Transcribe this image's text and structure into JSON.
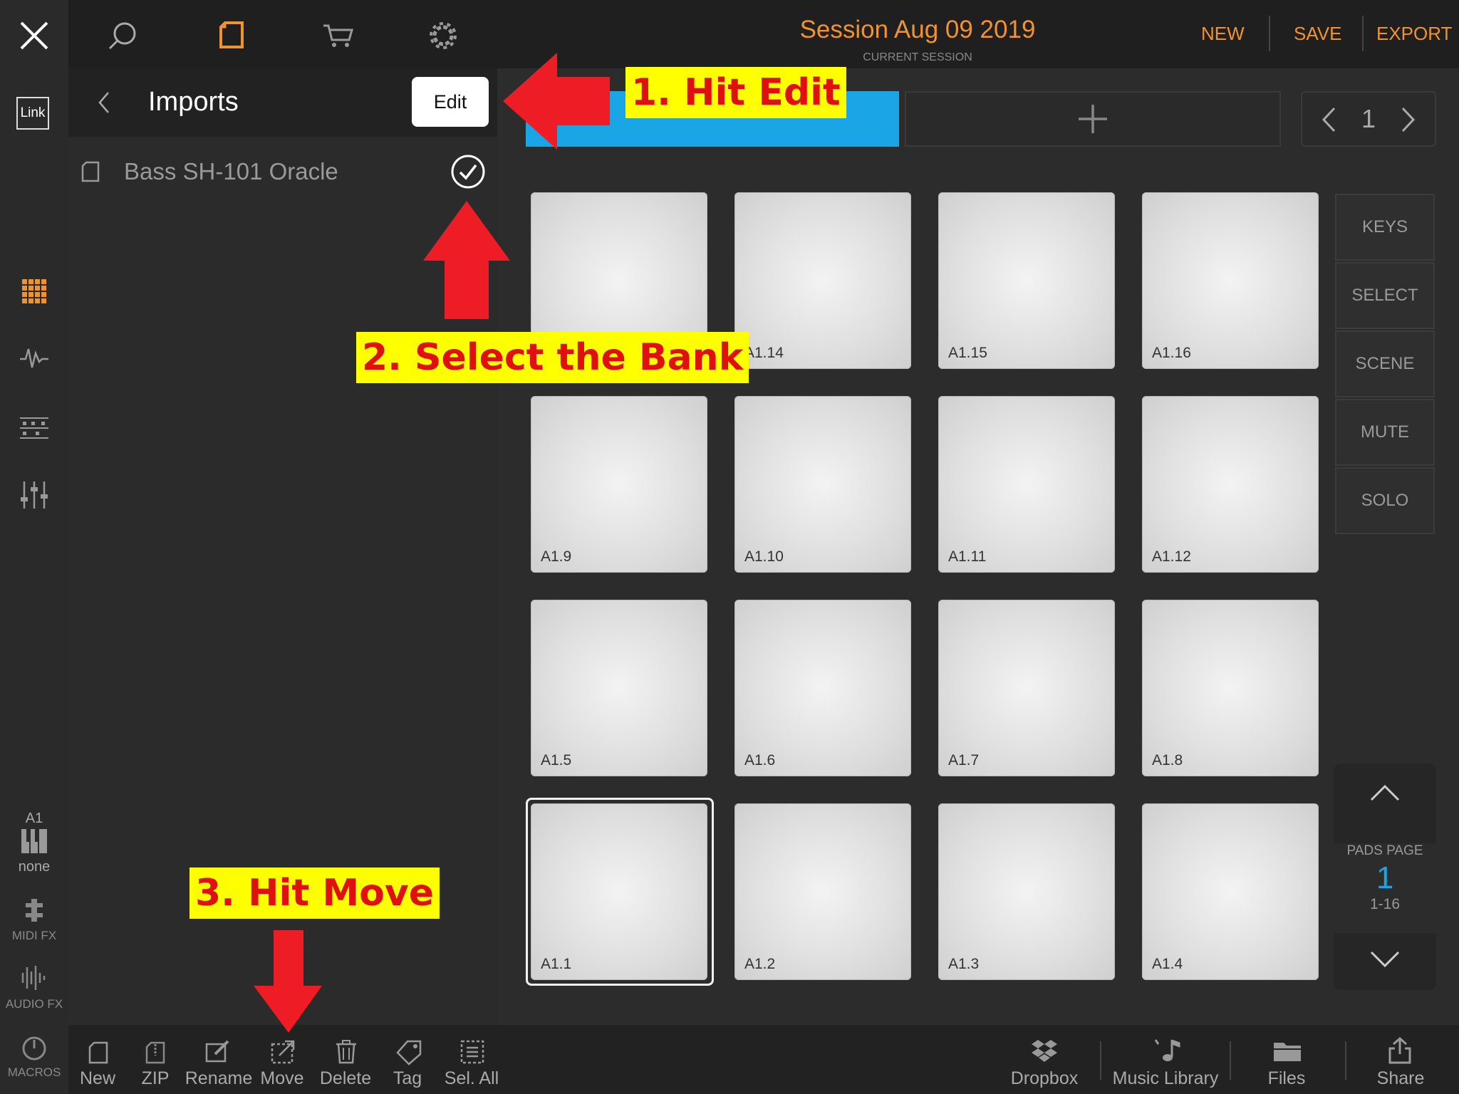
{
  "session": {
    "title": "Session Aug 09 2019",
    "subtitle": "CURRENT SESSION"
  },
  "header_actions": {
    "new": "NEW",
    "save": "SAVE",
    "export": "EXPORT"
  },
  "rail": {
    "link": "Link",
    "instrument_slot": "A1",
    "instrument_name": "none",
    "midi_fx": "MIDI FX",
    "audio_fx": "AUDIO FX",
    "macros": "MACROS"
  },
  "browser": {
    "title": "Imports",
    "edit_label": "Edit",
    "items": [
      {
        "label": "Bass SH-101 Oracle",
        "selected": true
      }
    ]
  },
  "scene": {
    "page": "1"
  },
  "pads": [
    {
      "label": ""
    },
    {
      "label": "A1.14"
    },
    {
      "label": "A1.15"
    },
    {
      "label": "A1.16"
    },
    {
      "label": "A1.9"
    },
    {
      "label": "A1.10"
    },
    {
      "label": "A1.11"
    },
    {
      "label": "A1.12"
    },
    {
      "label": "A1.5"
    },
    {
      "label": "A1.6"
    },
    {
      "label": "A1.7"
    },
    {
      "label": "A1.8"
    },
    {
      "label": "A1.1"
    },
    {
      "label": "A1.2"
    },
    {
      "label": "A1.3"
    },
    {
      "label": "A1.4"
    }
  ],
  "modes": [
    "KEYS",
    "SELECT",
    "SCENE",
    "MUTE",
    "SOLO"
  ],
  "pads_page": {
    "label": "PADS PAGE",
    "number": "1",
    "range": "1-16"
  },
  "toolbar": [
    "New",
    "ZIP",
    "Rename",
    "Move",
    "Delete",
    "Tag",
    "Sel. All"
  ],
  "sources": [
    "Dropbox",
    "Music Library",
    "Files",
    "Share"
  ],
  "annotations": {
    "step1": "1. Hit Edit",
    "step2": "2. Select the Bank",
    "step3": "3. Hit Move"
  },
  "colors": {
    "accent": "#f0922e",
    "scene_blue": "#1aa6e6",
    "annotation_bg": "#ffff00",
    "annotation_text": "#e01010",
    "arrow": "#ee1c24"
  }
}
